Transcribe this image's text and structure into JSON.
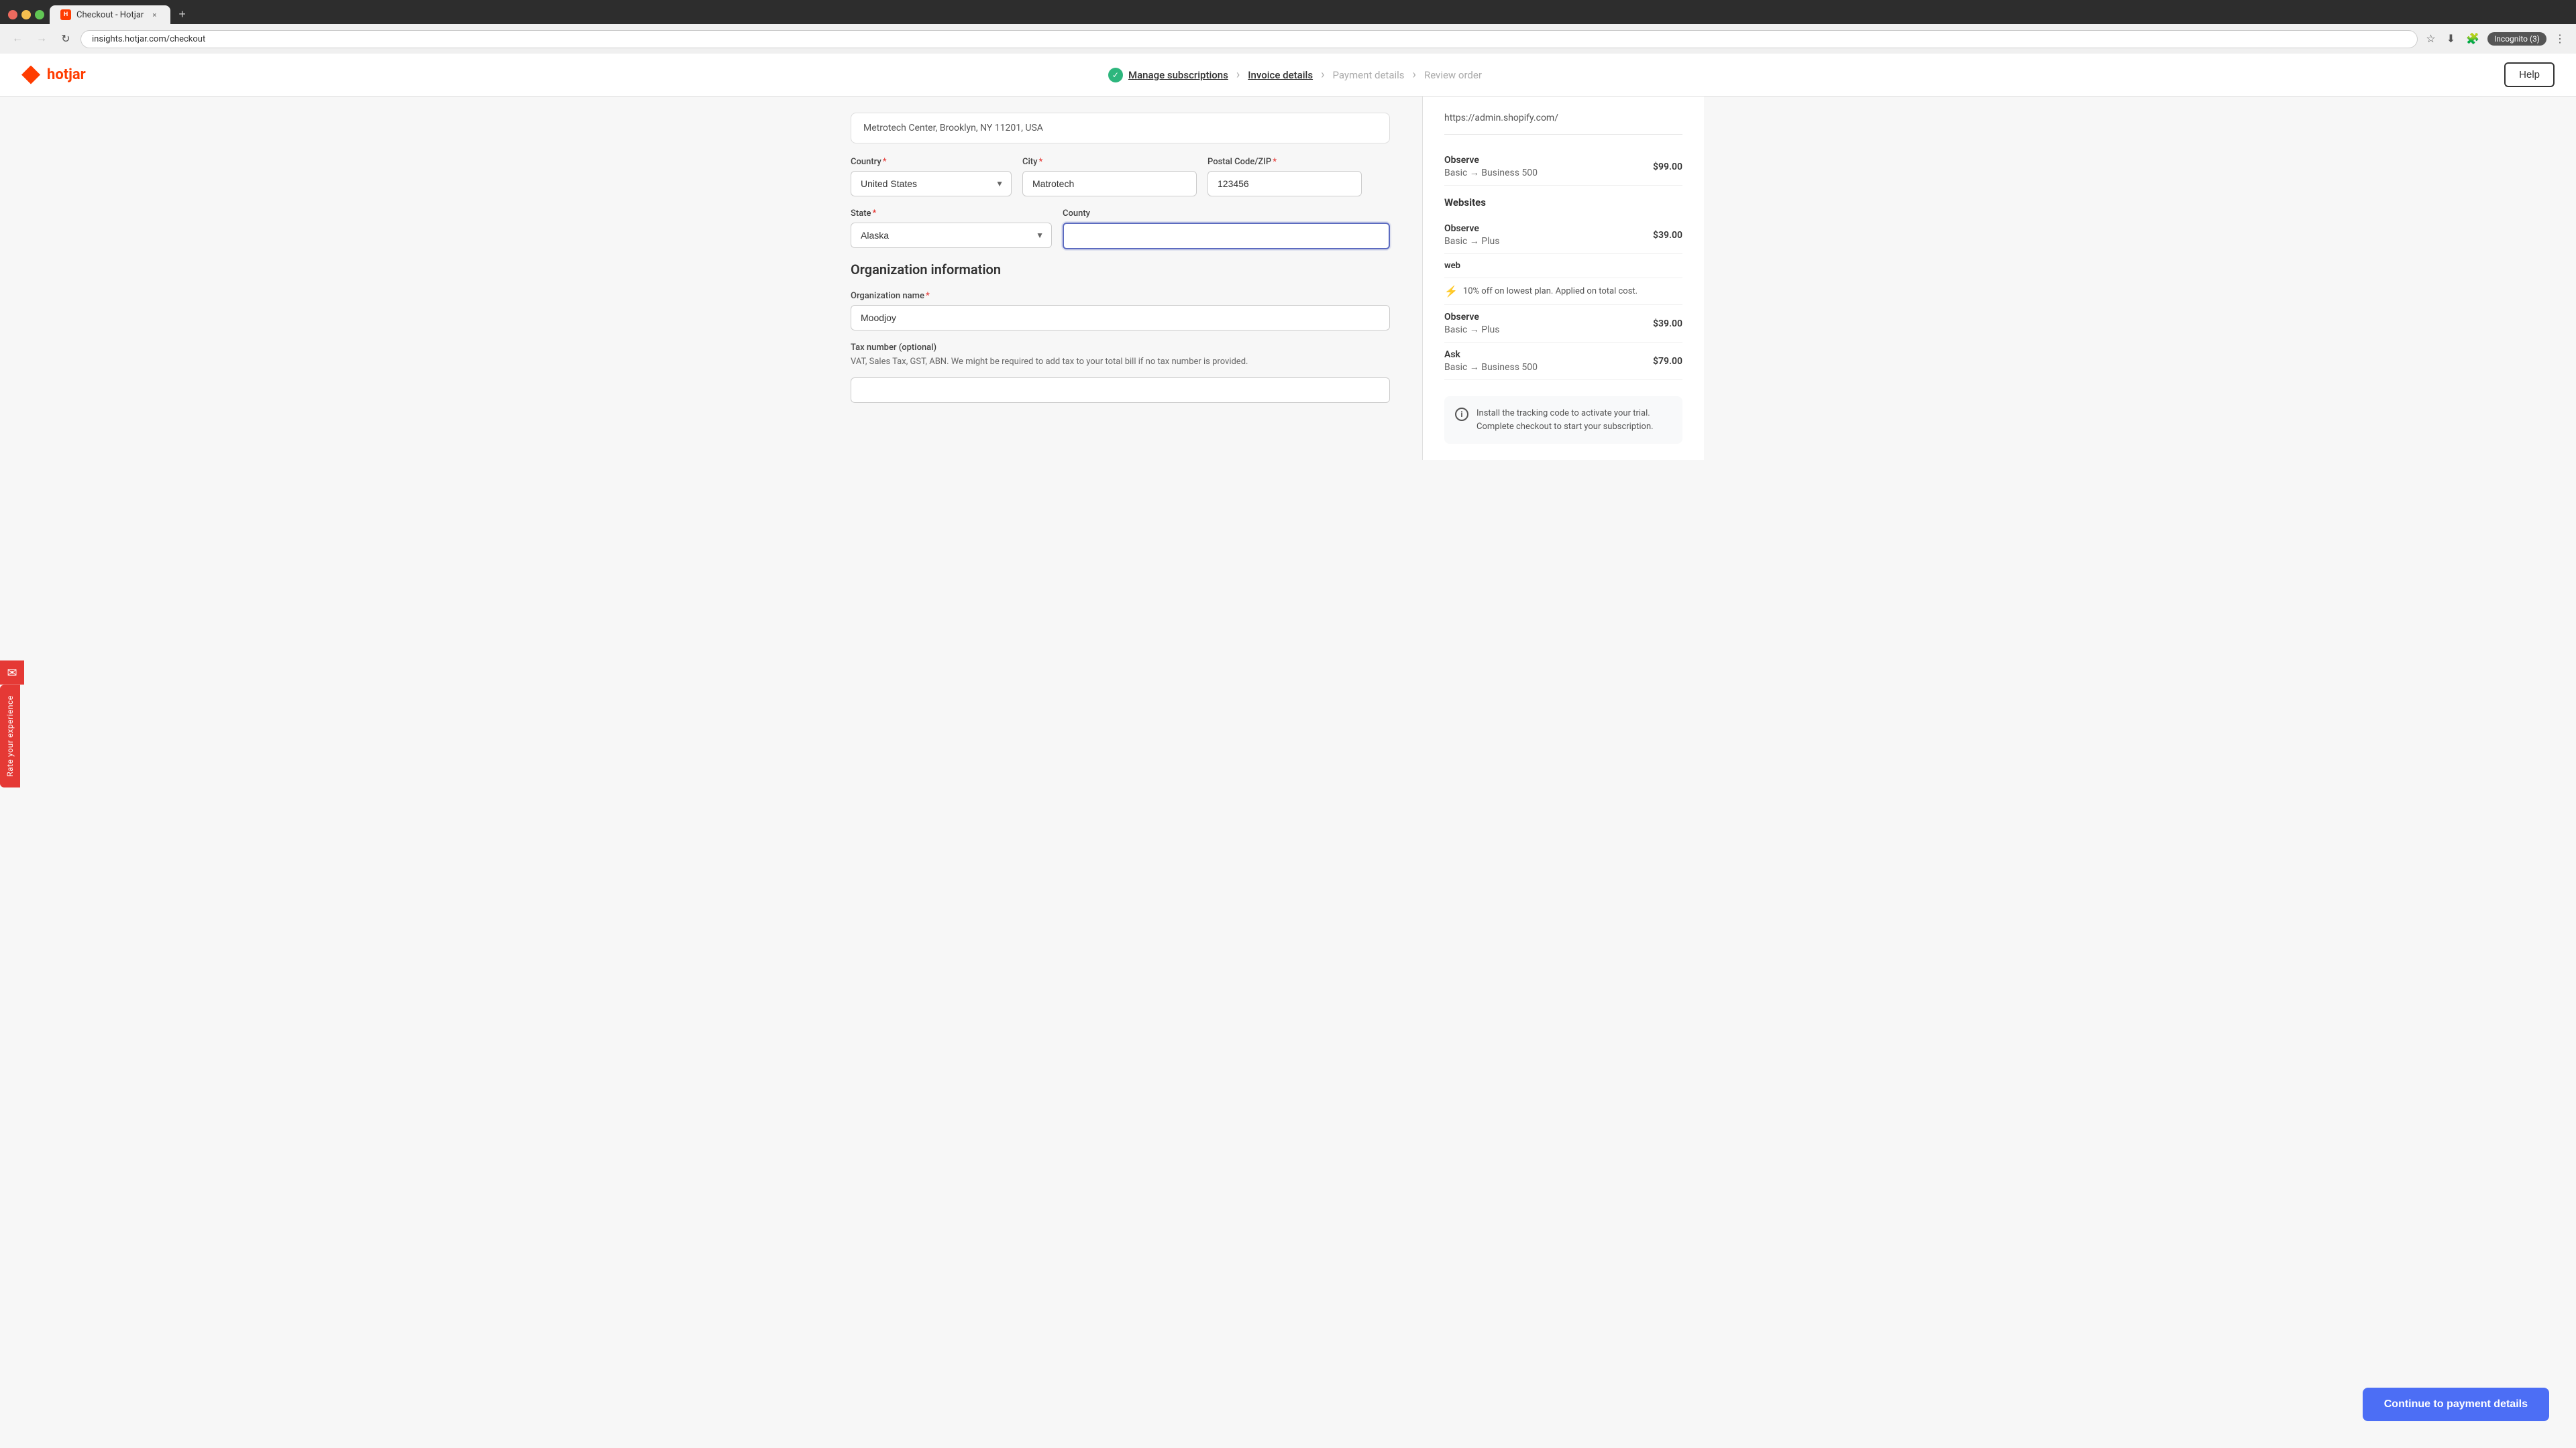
{
  "browser": {
    "tab_label": "Checkout - Hotjar",
    "url": "insights.hotjar.com/checkout",
    "new_tab_label": "+",
    "close_label": "×",
    "incognito_label": "Incognito (3)",
    "back_arrow": "←",
    "forward_arrow": "→",
    "reload_arrow": "↻",
    "more_icon": "⋮"
  },
  "header": {
    "logo_text": "hotjar",
    "help_button": "Help",
    "steps": [
      {
        "label": "Manage subscriptions",
        "active": true,
        "checked": true
      },
      {
        "label": "Invoice details",
        "active": true,
        "checked": false
      },
      {
        "label": "Payment details",
        "active": false,
        "checked": false
      },
      {
        "label": "Review order",
        "active": false,
        "checked": false
      }
    ]
  },
  "form": {
    "address_preview": "Metrotech Center, Brooklyn, NY 11201, USA",
    "country_label": "Country",
    "country_value": "United States",
    "city_label": "City",
    "city_value": "Matrotech",
    "postal_label": "Postal Code/ZIP",
    "postal_value": "123456",
    "state_label": "State",
    "state_value": "Alaska",
    "county_label": "County",
    "county_value": "",
    "county_placeholder": "",
    "org_section_title": "Organization information",
    "org_name_label": "Organization name",
    "org_name_value": "Moodjoy",
    "tax_label": "Tax number (optional)",
    "tax_note": "VAT, Sales Tax, GST, ABN. We might be required to add tax to your total bill if no tax number is provided.",
    "tax_value": "",
    "tax_placeholder": ""
  },
  "sidebar": {
    "url": "https://admin.shopify.com/",
    "websites_section": "Websites",
    "order_rows": [
      {
        "product": "Observe",
        "detail": "Basic → Business 500",
        "price": "$99.00"
      },
      {
        "product": "Observe",
        "detail": "Basic → Plus",
        "price": "$39.00"
      },
      {
        "product": "web",
        "discount": "10% off on lowest plan. Applied on total cost.",
        "is_discount": true
      },
      {
        "product": "Observe",
        "detail": "Basic → Plus",
        "price": "$39.00"
      },
      {
        "product": "Ask",
        "detail": "Basic → Business 500",
        "price": "$79.00"
      }
    ],
    "install_notice": "Install the tracking code to activate your trial. Complete checkout to start your subscription.",
    "continue_button": "Continue to payment details"
  },
  "rate_experience": {
    "label": "Rate your experience"
  }
}
